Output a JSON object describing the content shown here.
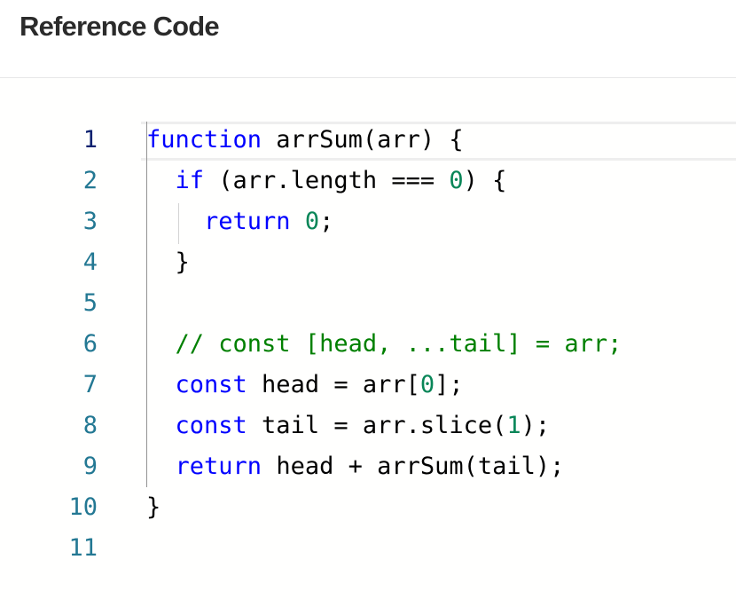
{
  "header": {
    "title": "Reference Code"
  },
  "editor": {
    "language": "javascript",
    "active_line": 1,
    "colors": {
      "keyword": "#0000ff",
      "number": "#098658",
      "comment": "#008000",
      "line_number": "#237893",
      "active_line_number": "#0b216f",
      "text": "#000000"
    },
    "lines": [
      {
        "number": "1",
        "tokens": [
          {
            "text": "function",
            "type": "kw"
          },
          {
            "text": " arrSum(arr) {",
            "type": "op"
          }
        ]
      },
      {
        "number": "2",
        "tokens": [
          {
            "text": "  ",
            "type": "op"
          },
          {
            "text": "if",
            "type": "kw"
          },
          {
            "text": " (arr.length === ",
            "type": "op"
          },
          {
            "text": "0",
            "type": "num"
          },
          {
            "text": ") {",
            "type": "op"
          }
        ]
      },
      {
        "number": "3",
        "tokens": [
          {
            "text": "    ",
            "type": "op"
          },
          {
            "text": "return",
            "type": "kw"
          },
          {
            "text": " ",
            "type": "op"
          },
          {
            "text": "0",
            "type": "num"
          },
          {
            "text": ";",
            "type": "op"
          }
        ]
      },
      {
        "number": "4",
        "tokens": [
          {
            "text": "  }",
            "type": "op"
          }
        ]
      },
      {
        "number": "5",
        "tokens": []
      },
      {
        "number": "6",
        "tokens": [
          {
            "text": "  ",
            "type": "op"
          },
          {
            "text": "// const [head, ...tail] = arr;",
            "type": "cm"
          }
        ]
      },
      {
        "number": "7",
        "tokens": [
          {
            "text": "  ",
            "type": "op"
          },
          {
            "text": "const",
            "type": "kw"
          },
          {
            "text": " head = arr[",
            "type": "op"
          },
          {
            "text": "0",
            "type": "num"
          },
          {
            "text": "];",
            "type": "op"
          }
        ]
      },
      {
        "number": "8",
        "tokens": [
          {
            "text": "  ",
            "type": "op"
          },
          {
            "text": "const",
            "type": "kw"
          },
          {
            "text": " tail = arr.slice(",
            "type": "op"
          },
          {
            "text": "1",
            "type": "num"
          },
          {
            "text": ");",
            "type": "op"
          }
        ]
      },
      {
        "number": "9",
        "tokens": [
          {
            "text": "  ",
            "type": "op"
          },
          {
            "text": "return",
            "type": "kw"
          },
          {
            "text": " head + arrSum(tail);",
            "type": "op"
          }
        ]
      },
      {
        "number": "10",
        "tokens": [
          {
            "text": "}",
            "type": "op"
          }
        ]
      },
      {
        "number": "11",
        "tokens": []
      }
    ]
  }
}
